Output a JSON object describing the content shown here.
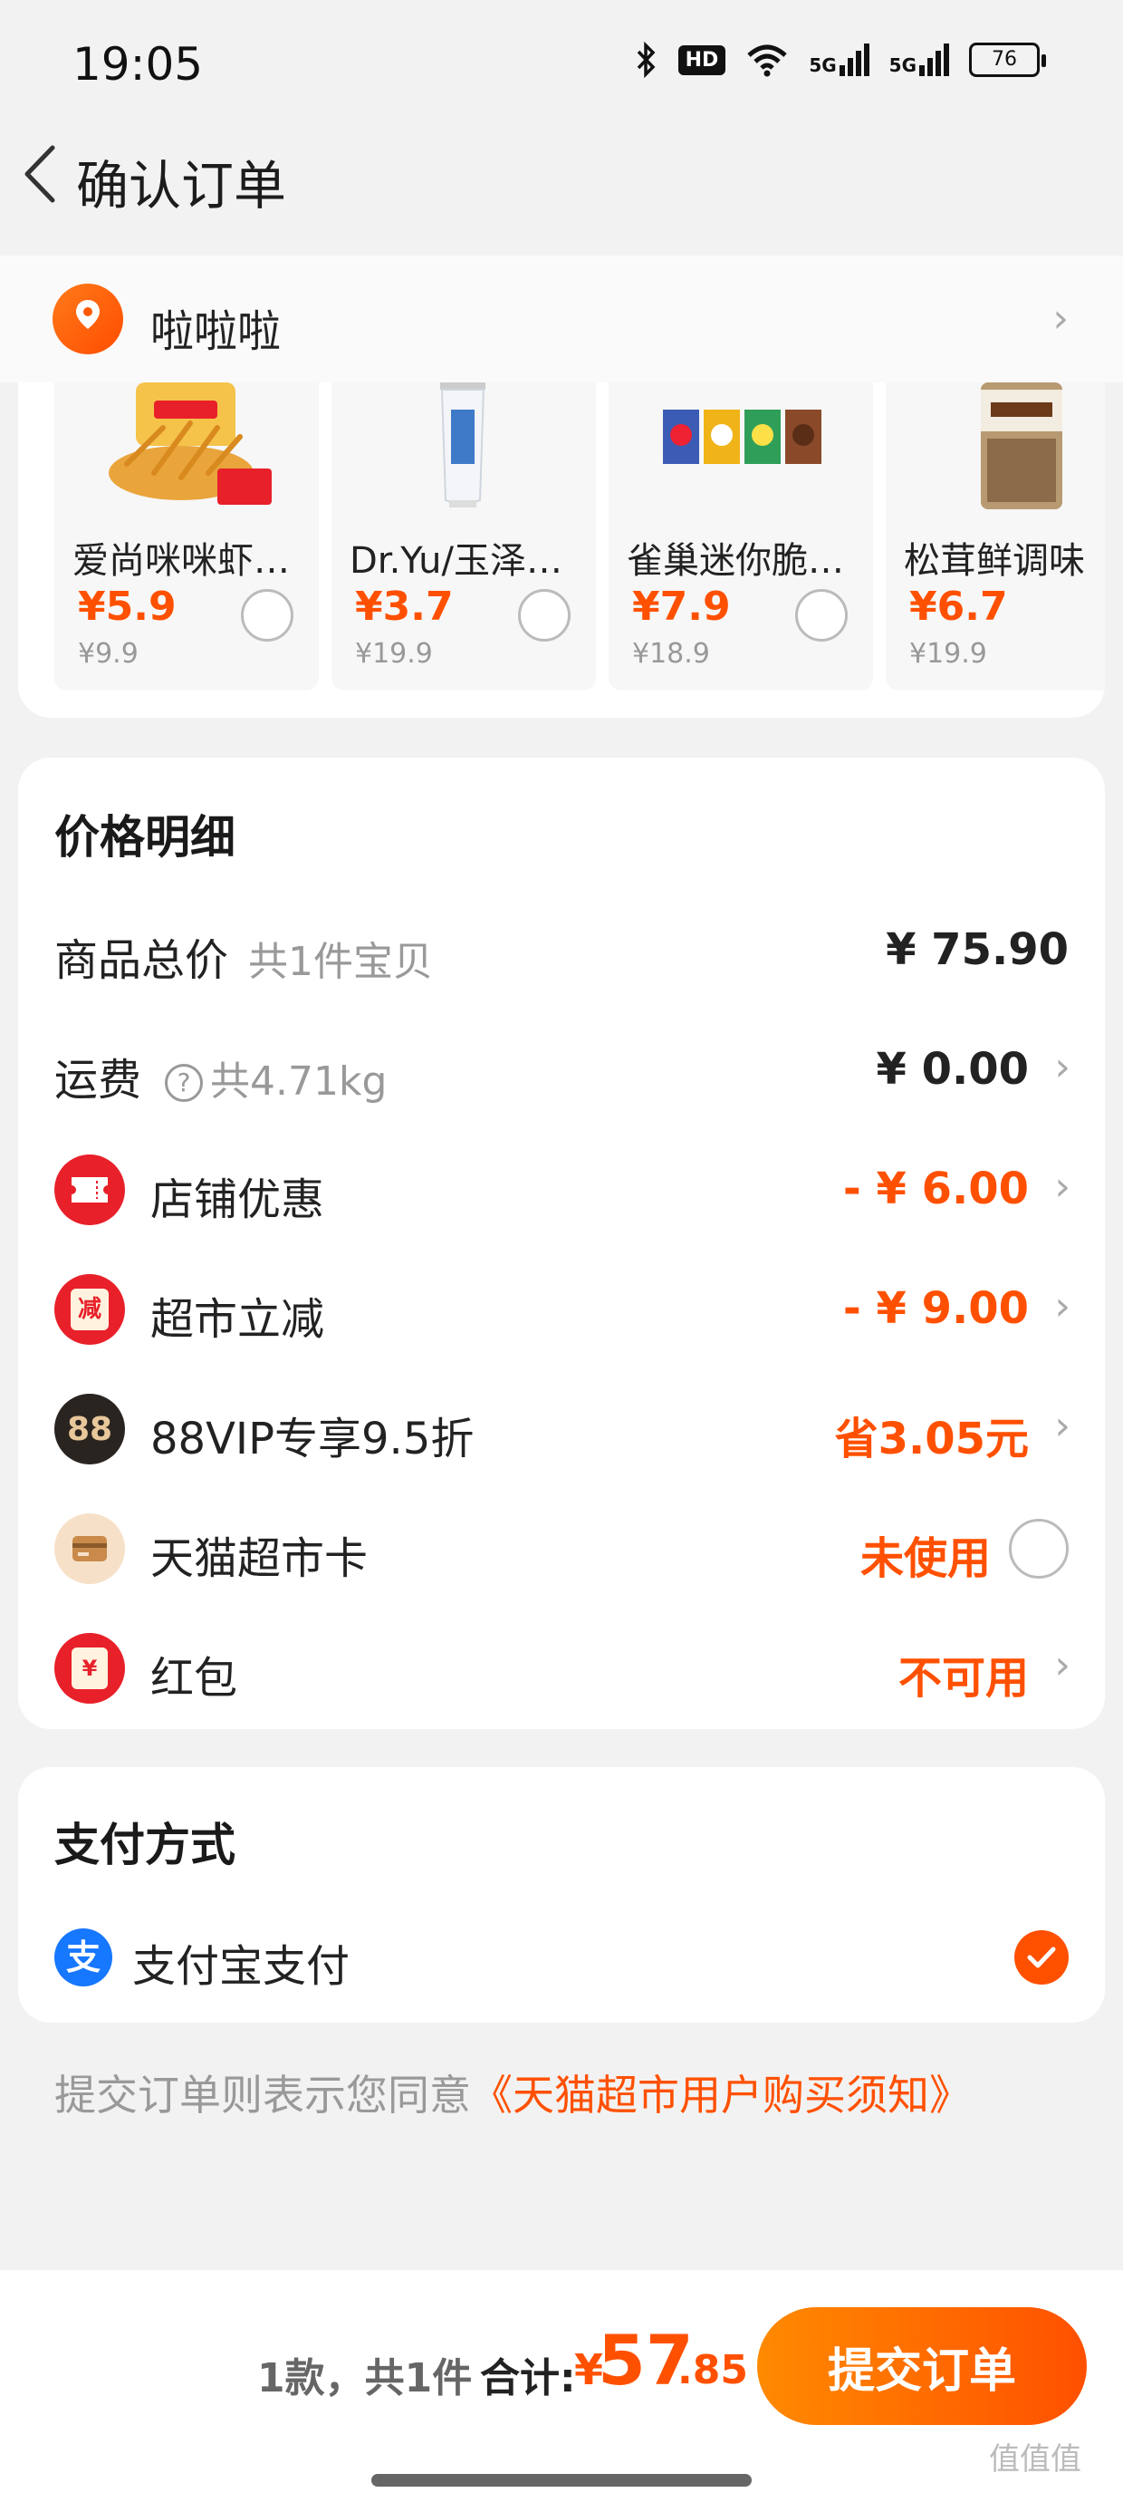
{
  "status_bar": {
    "time": "19:05",
    "hd_label": "HD",
    "network_1": "5G",
    "network_2": "5G",
    "battery": "76"
  },
  "header": {
    "title": "确认订单"
  },
  "address": {
    "name": "啦啦啦"
  },
  "products": [
    {
      "name": "爱尚咪咪虾味…",
      "price": "¥5.9",
      "original": "¥9.9"
    },
    {
      "name": "Dr.Yu/玉泽洁面",
      "price": "¥3.7",
      "original": "¥19.9"
    },
    {
      "name": "雀巢迷你脆谷…",
      "price": "¥7.9",
      "original": "¥18.9"
    },
    {
      "name": "松茸鲜调味",
      "price": "¥6.7",
      "original": "¥19.9"
    }
  ],
  "price_detail": {
    "title": "价格明细",
    "goods_total": {
      "label": "商品总价",
      "sub": "共1件宝贝",
      "value": "¥ 75.90"
    },
    "shipping": {
      "label": "运费",
      "sub": "共4.71kg",
      "value": "¥ 0.00"
    },
    "store_discount": {
      "label": "店铺优惠",
      "value": "- ¥ 6.00"
    },
    "market_discount": {
      "label": "超市立减",
      "value": "- ¥ 9.00",
      "icon_text": "减"
    },
    "vip": {
      "label": "88VIP专享9.5折",
      "value": "省3.05元",
      "icon_text": "88"
    },
    "card": {
      "label": "天猫超市卡",
      "value": "未使用"
    },
    "red_packet": {
      "label": "红包",
      "value": "不可用",
      "icon_text": "¥"
    }
  },
  "payment": {
    "title": "支付方式",
    "method": "支付宝支付",
    "icon_text": "支"
  },
  "agreement": {
    "text": "提交订单则表示您同意",
    "link": "《天猫超市用户购买须知》"
  },
  "bottom": {
    "count": "1款，共1件",
    "total_label": "合计:",
    "currency": "¥",
    "total_int": "57",
    "total_dec": ".85",
    "submit": "提交订单"
  },
  "watermark": "值值值",
  "colors": {
    "accent": "#ff5000",
    "alipay": "#1677ff",
    "red_icon": "#e8202a"
  }
}
